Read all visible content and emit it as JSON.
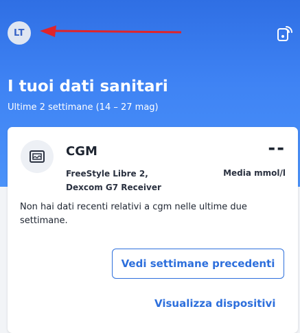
{
  "header": {
    "avatar_initials": "LT",
    "title": "I tuoi dati sanitari",
    "subtitle": "Ultime 2 settimane (14 – 27 mag)"
  },
  "icons": {
    "device": "connected-device-icon",
    "cgm": "cgm-monitor-icon",
    "annotation": "red-arrow-annotation"
  },
  "colors": {
    "header_gradient_top": "#2f6fe4",
    "header_gradient_bottom": "#4a92f9",
    "accent": "#2d6fdc",
    "annotation_arrow": "#e0242a"
  },
  "cgm_card": {
    "title": "CGM",
    "devices_line1": "FreeStyle Libre 2,",
    "devices_line2": "Dexcom G7 Receiver",
    "value": "--",
    "unit": "Media mmol/l",
    "message": "Non hai dati recenti relativi a cgm nelle ultime due settimane.",
    "primary_button": "Vedi settimane precedenti",
    "link": "Visualizza dispositivi"
  }
}
